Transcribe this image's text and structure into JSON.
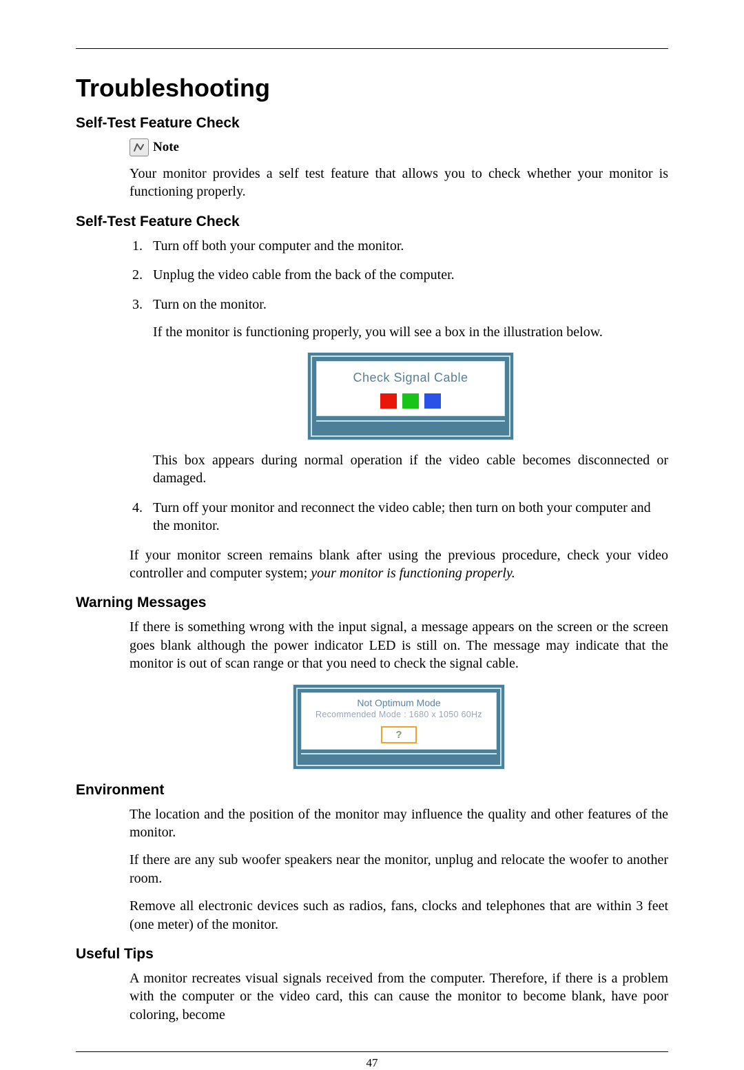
{
  "page_number": "47",
  "title": "Troubleshooting",
  "sections": {
    "s1": {
      "heading": "Self-Test Feature Check",
      "note_label": "Note",
      "note_body": "Your monitor provides a self test feature that allows you to check whether your monitor is functioning properly."
    },
    "s2": {
      "heading": "Self-Test Feature Check",
      "steps": {
        "i1": "Turn off both your computer and the monitor.",
        "i2": "Unplug the video cable from the back of the computer.",
        "i3": "Turn on the monitor.",
        "i3_sub": "If the monitor is functioning properly, you will see a box in the illustration below.",
        "i3_after": "This box appears during normal operation if the video cable becomes disconnected or damaged.",
        "i4": "Turn off your monitor and reconnect the video cable; then turn on both your computer and the monitor."
      },
      "closing": "If your monitor screen remains blank after using the previous procedure, check your video controller and computer system; ",
      "closing_italic": "your monitor is functioning properly.",
      "figure": {
        "text": "Check Signal Cable"
      }
    },
    "s3": {
      "heading": "Warning Messages",
      "body": "If there is something wrong with the input signal, a message appears on the screen or the screen goes blank although the power indicator LED is still on. The message may indicate that the monitor is out of scan range or that you need to check the signal cable.",
      "figure": {
        "line1": "Not Optimum Mode",
        "line2": "Recommended Mode : 1680 x  1050 60Hz",
        "q": "?"
      }
    },
    "s4": {
      "heading": "Environment",
      "p1": "The location and the position of the monitor may influence the quality and other features of the monitor.",
      "p2": "If there are any sub woofer speakers near the monitor, unplug and relocate the woofer to another room.",
      "p3": "Remove all electronic devices such as radios, fans, clocks and telephones that are within 3 feet (one meter) of the monitor."
    },
    "s5": {
      "heading": "Useful Tips",
      "p1": "A monitor recreates visual signals received from the computer. Therefore, if there is a problem with the computer or the video card, this can cause the monitor to become blank, have poor coloring, become"
    }
  }
}
